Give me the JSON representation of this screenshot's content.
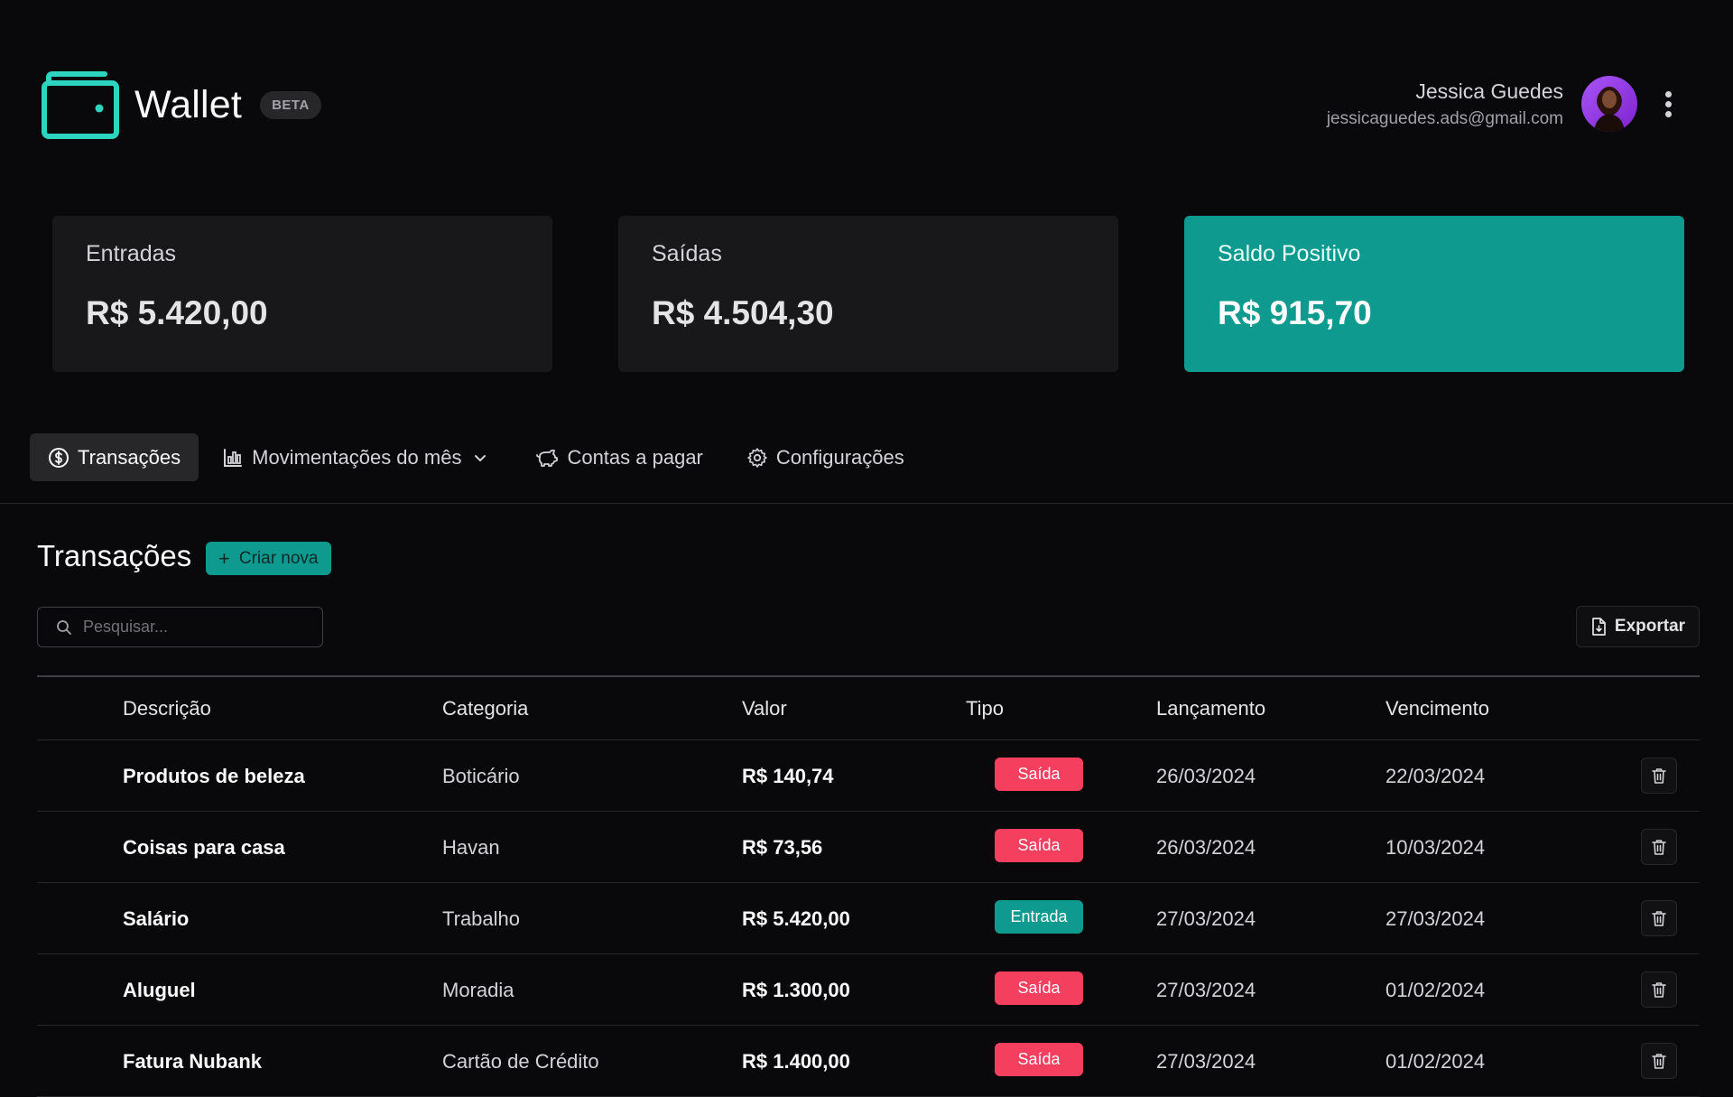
{
  "header": {
    "brand_name": "Wallet",
    "beta_label": "BETA",
    "user_name": "Jessica Guedes",
    "user_email": "jessicaguedes.ads@gmail.com"
  },
  "summary": [
    {
      "label": "Entradas",
      "value": "R$ 5.420,00"
    },
    {
      "label": "Saídas",
      "value": "R$ 4.504,30"
    },
    {
      "label": "Saldo Positivo",
      "value": "R$ 915,70"
    }
  ],
  "tabs": [
    {
      "label": "Transações",
      "icon": "dollar-circle-icon",
      "active": true
    },
    {
      "label": "Movimentações do mês",
      "icon": "bar-chart-icon",
      "active": false
    },
    {
      "label": "Contas a pagar",
      "icon": "piggy-bank-icon",
      "active": false
    },
    {
      "label": "Configurações",
      "icon": "gear-icon",
      "active": false
    }
  ],
  "transactions": {
    "title": "Transações",
    "new_button": "Criar nova",
    "search_placeholder": "Pesquisar...",
    "export_button": "Exportar",
    "columns": [
      "Descrição",
      "Categoria",
      "Valor",
      "Tipo",
      "Lançamento",
      "Vencimento"
    ],
    "rows": [
      {
        "descricao": "Produtos de beleza",
        "categoria": "Boticário",
        "valor": "R$ 140,74",
        "tipo": "Saída",
        "lancamento": "26/03/2024",
        "vencimento": "22/03/2024"
      },
      {
        "descricao": "Coisas para casa",
        "categoria": "Havan",
        "valor": "R$ 73,56",
        "tipo": "Saída",
        "lancamento": "26/03/2024",
        "vencimento": "10/03/2024"
      },
      {
        "descricao": "Salário",
        "categoria": "Trabalho",
        "valor": "R$ 5.420,00",
        "tipo": "Entrada",
        "lancamento": "27/03/2024",
        "vencimento": "27/03/2024"
      },
      {
        "descricao": "Aluguel",
        "categoria": "Moradia",
        "valor": "R$ 1.300,00",
        "tipo": "Saída",
        "lancamento": "27/03/2024",
        "vencimento": "01/02/2024"
      },
      {
        "descricao": "Fatura Nubank",
        "categoria": "Cartão de Crédito",
        "valor": "R$ 1.400,00",
        "tipo": "Saída",
        "lancamento": "27/03/2024",
        "vencimento": "01/02/2024"
      }
    ]
  },
  "colors": {
    "accent": "#0f9a8f",
    "saida": "#f43f5e",
    "background": "#09090b",
    "card": "#18181b"
  }
}
